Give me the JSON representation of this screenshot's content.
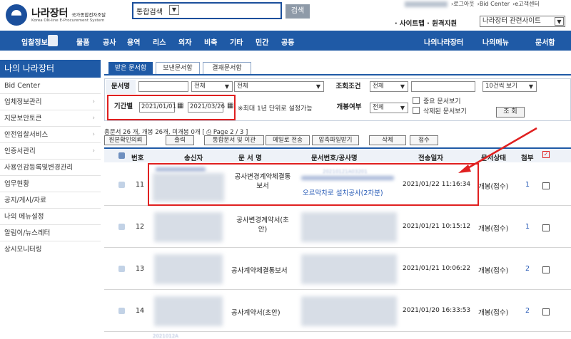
{
  "header": {
    "logo_name": "나라장터",
    "logo_name_sub": "국가종합전자조달",
    "logo_tagline": "Korea ON-line E-Procurement System",
    "search_scope": "통합검색",
    "search_button": "검색",
    "util_links": [
      "›로그아웃",
      "›Bid Center",
      "›e고객센터"
    ],
    "util2_text": "· 사이트맵 · 원격지원",
    "related_sites": "나라장터 관련사이트"
  },
  "nav": {
    "items": [
      "입찰정보",
      "물품",
      "공사",
      "용역",
      "리스",
      "외자",
      "비축",
      "기타",
      "민간",
      "공동"
    ],
    "right_items": [
      "나의나라장터",
      "나의메뉴",
      "문서함"
    ]
  },
  "sidebar": {
    "title": "나의 나라장터",
    "items": [
      {
        "label": "Bid Center",
        "arrow": false
      },
      {
        "label": "업체정보관리",
        "arrow": true
      },
      {
        "label": "지문보안토큰",
        "arrow": true
      },
      {
        "label": "안전입찰서비스",
        "arrow": true
      },
      {
        "label": "인증서관리",
        "arrow": true
      },
      {
        "label": "사용인감등록및변경관리",
        "arrow": false
      },
      {
        "label": "업무현황",
        "arrow": false
      },
      {
        "label": "공지/게시/자료",
        "arrow": false
      },
      {
        "label": "나의 메뉴설정",
        "arrow": false
      },
      {
        "label": "알림이/뉴스레터",
        "arrow": false
      },
      {
        "label": "상시모니터링",
        "arrow": false
      }
    ]
  },
  "tabs": [
    "받은 문서함",
    "보낸문서함",
    "결재문서함"
  ],
  "filters": {
    "doc_name_label": "문서명",
    "doc_select1": "전체",
    "doc_select2": "전체",
    "query_label": "조회조건",
    "query_select": "전체",
    "page_size": "10건씩 보기",
    "period_label": "기간별",
    "date_from": "2021/01/01",
    "date_to": "2021/03/26",
    "period_note": "※최대 1년 단위로 설정가능",
    "opened_label": "개봉여부",
    "opened_select": "전체",
    "important_docs": "중요 문서보기",
    "deleted_docs": "삭제된 문서보기",
    "search_button": "조 회"
  },
  "summary": "총문서 26 개, 개봉 26개, 미개봉 0개 [ ⎙ Page 2 / 3 ]",
  "actions": [
    "원본확인의뢰",
    "출력",
    "통합문서 및 이관",
    "메일로 전송",
    "압축파일받기",
    "삭제",
    "접수"
  ],
  "table": {
    "headers": [
      "번호",
      "송신자",
      "문 서 명",
      "문서번호/공사명",
      "전송일자",
      "문서상태",
      "첨부"
    ],
    "rows": [
      {
        "no": "11",
        "doc_name": "공사변경계약체결통\n보서",
        "doc_no": "20210121A03201",
        "project": "오르막차로 설치공사(2차분)",
        "date": "2021/01/22 11:16:34",
        "status": "개봉(접수)",
        "attach": "1"
      },
      {
        "no": "12",
        "doc_name": "공사변경계약서(초\n안)",
        "doc_no": "",
        "project": "",
        "date": "2021/01/21 10:15:12",
        "status": "개봉(접수)",
        "attach": "1"
      },
      {
        "no": "13",
        "doc_name": "공사계약체결통보서",
        "doc_no": "",
        "project": "",
        "date": "2021/01/21 10:06:22",
        "status": "개봉(접수)",
        "attach": "2"
      },
      {
        "no": "14",
        "doc_name": "공사계약서(초안)",
        "doc_no": "",
        "project": "",
        "date": "2021/01/20 16:33:53",
        "status": "개봉(접수)",
        "attach": "2"
      }
    ],
    "last_row_partial": "2021012A"
  },
  "colors": {
    "accent": "#1f5aa6",
    "highlight": "#e02020",
    "link": "#2458b5"
  }
}
